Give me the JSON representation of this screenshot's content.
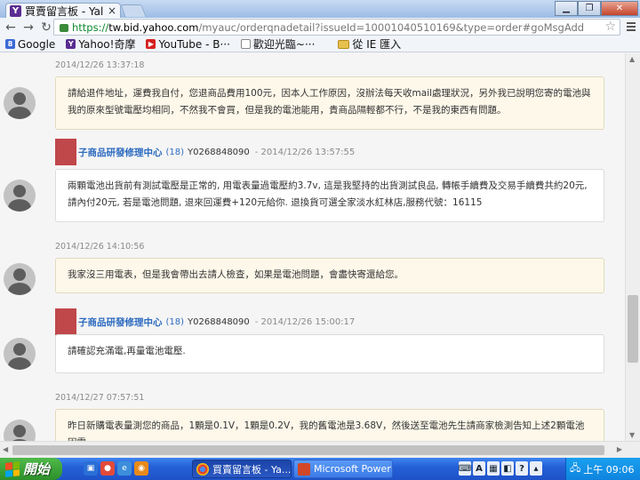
{
  "browser": {
    "tab_title": "買賣留言板 - Yal",
    "tab_close": "×",
    "url_scheme": "https://",
    "url_host": "tw.bid.yahoo.com",
    "url_path": "/myauc/orderqnadetail?issueId=10001040510169&type=order#goMsgAdd",
    "bookmarks": [
      {
        "label": "Google",
        "icon": "google-icon"
      },
      {
        "label": "Yahoo!奇摩",
        "icon": "yahoo-icon"
      },
      {
        "label": "YouTube - B···",
        "icon": "youtube-icon"
      },
      {
        "label": "歡迎光臨~···",
        "icon": "page-icon"
      },
      {
        "label": "從 IE 匯入",
        "icon": "folder-icon"
      }
    ]
  },
  "messages": [
    {
      "type": "buyer",
      "timestamp": "2014/12/26 13:37:18",
      "text": "請給退件地址，運費我自付，您退商品費用100元，因本人工作原因，沒辦法每天收mail處理狀況，另外我已說明您寄的電池與我的原來型號電壓均相同，不然我不會買，但是我的電池能用，貴商品隔輕都不行，不是我的東西有問題。"
    },
    {
      "type": "seller",
      "shop": "子商品研發修理中心",
      "rating": "(18)",
      "seller_id": "Y0268848090",
      "timestamp": "- 2014/12/26 13:57:55",
      "text": "兩顆電池出貨前有測試電壓是正常的, 用電表量過電壓約3.7v, 這是我堅持的出貨測試良品, 轉帳手續費及交易手續費共約20元, 請內付20元, 若是電池問題, 退來回運費+120元給你. 退換貨可選全家淡水紅林店,服務代號：16115"
    },
    {
      "type": "buyer",
      "timestamp": "2014/12/26 14:10:56",
      "text": "我家沒三用電表，但是我會帶出去請人檢查，如果是電池問題，會盡快寄還給您。"
    },
    {
      "type": "seller",
      "shop": "子商品研發修理中心",
      "rating": "(18)",
      "seller_id": "Y0268848090",
      "timestamp": "- 2014/12/26 15:00:17",
      "text": "請確認充滿電,再量電池電壓."
    },
    {
      "type": "buyer",
      "timestamp": "2014/12/27 07:57:51",
      "text": "昨日新購電表量測您的商品，1顆是0.1V，1顆是0.2V，我的舊電池是3.68V，然後送至電池先生請商家檢測告知上述2顆電池因電"
    }
  ],
  "taskbar": {
    "start_label": "開始",
    "tasks": [
      {
        "label": "買賣留言板 - Ya...",
        "active": true
      },
      {
        "label": "Microsoft PowerP...",
        "active": false
      }
    ],
    "tray_time": "上午 09:06",
    "tray_lang": "A"
  }
}
